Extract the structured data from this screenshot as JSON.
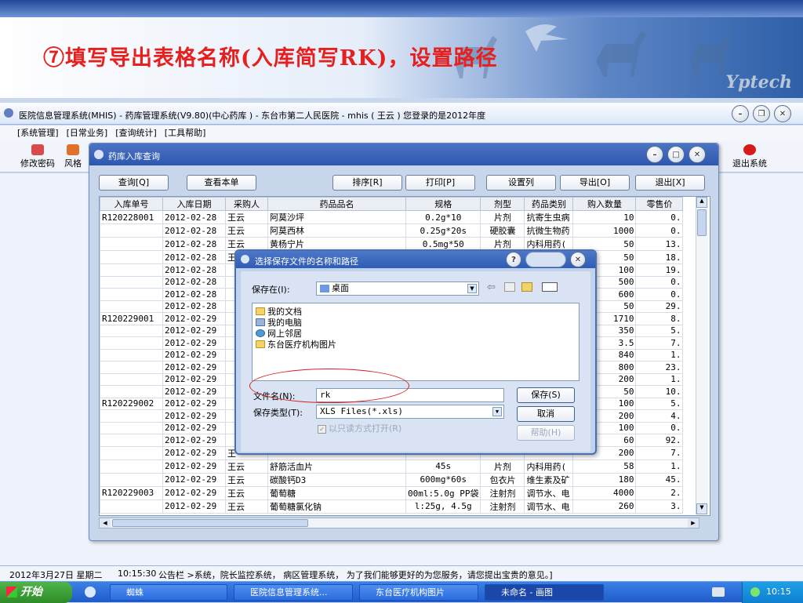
{
  "banner": {
    "title": "⑦填写导出表格名称(入库简写RK)，设置路径",
    "brand": "Yptech"
  },
  "main_window": {
    "title": "医院信息管理系统(MHIS) - 药库管理系统(V9.80)(中心药库 ) - 东台市第二人民医院 - mhis ( 王云 ) 您登录的是2012年度"
  },
  "menu": [
    "[系统管理]",
    "[日常业务]",
    "[查询统计]",
    "[工具帮助]"
  ],
  "toolbar": {
    "change_password": "修改密码",
    "style": "风格",
    "exit": "退出系统"
  },
  "child": {
    "title": "药库入库查询",
    "buttons": {
      "query": "查询[Q]",
      "view_detail": "查看本单",
      "sort": "排序[R]",
      "print": "打印[P]",
      "set_columns": "设置列",
      "export": "导出[O]",
      "exit": "退出[X]"
    }
  },
  "table": {
    "headers": [
      "入库单号",
      "入库日期",
      "采购人",
      "药品品名",
      "规格",
      "剂型",
      "药品类别",
      "购入数量",
      "零售价"
    ],
    "rows": [
      [
        "R120228001",
        "2012-02-28",
        "王云",
        "阿莫沙坪",
        "0.2g*10",
        "片剂",
        "抗寄生虫病",
        "10",
        "0."
      ],
      [
        "",
        "2012-02-28",
        "王云",
        "阿莫西林",
        "0.25g*20s",
        "硬胶囊",
        "抗微生物药",
        "1000",
        "0."
      ],
      [
        "",
        "2012-02-28",
        "王云",
        "黄杨宁片",
        "0.5mg*50",
        "片剂",
        "内科用药(",
        "50",
        "13."
      ],
      [
        "",
        "2012-02-28",
        "王云",
        "健胃消炎颗粒",
        "5g*6",
        "颗粒剂",
        "",
        "50",
        "18."
      ],
      [
        "",
        "2012-02-28",
        "",
        "",
        "",
        "",
        "",
        "100",
        "19."
      ],
      [
        "",
        "2012-02-28",
        "",
        "",
        "",
        "",
        "",
        "500",
        "0."
      ],
      [
        "",
        "2012-02-28",
        "",
        "",
        "",
        "",
        "",
        "600",
        "0."
      ],
      [
        "",
        "2012-02-28",
        "",
        "",
        "",
        "",
        "",
        "50",
        "29."
      ],
      [
        "R120229001",
        "2012-02-29",
        "",
        "",
        "",
        "",
        "",
        "1710",
        "8."
      ],
      [
        "",
        "2012-02-29",
        "",
        "",
        "",
        "",
        "",
        "350",
        "5."
      ],
      [
        "",
        "2012-02-29",
        "",
        "",
        "",
        "",
        "",
        "3.5",
        "7."
      ],
      [
        "",
        "2012-02-29",
        "",
        "",
        "",
        "",
        "",
        "840",
        "1."
      ],
      [
        "",
        "2012-02-29",
        "",
        "",
        "",
        "",
        "",
        "800",
        "23."
      ],
      [
        "",
        "2012-02-29",
        "",
        "",
        "",
        "",
        "",
        "200",
        "1."
      ],
      [
        "",
        "2012-02-29",
        "",
        "",
        "",
        "",
        "",
        "50",
        "10."
      ],
      [
        "R120229002",
        "2012-02-29",
        "",
        "",
        "",
        "",
        "",
        "100",
        "5."
      ],
      [
        "",
        "2012-02-29",
        "",
        "",
        "",
        "",
        "",
        "200",
        "4."
      ],
      [
        "",
        "2012-02-29",
        "",
        "",
        "",
        "",
        "",
        "100",
        "0."
      ],
      [
        "",
        "2012-02-29",
        "",
        "",
        "",
        "",
        "",
        "60",
        "92."
      ],
      [
        "",
        "2012-02-29",
        "王",
        "",
        "",
        "",
        "",
        "200",
        "7."
      ],
      [
        "",
        "2012-02-29",
        "王云",
        "舒筋活血片",
        "45s",
        "片剂",
        "内科用药(",
        "58",
        "1."
      ],
      [
        "",
        "2012-02-29",
        "王云",
        "碳酸钙D3",
        "600mg*60s",
        "包衣片",
        "维生素及矿",
        "180",
        "45."
      ],
      [
        "R120229003",
        "2012-02-29",
        "王云",
        "葡萄糖",
        "00ml:5.0g PP袋",
        "注射剂",
        "调节水、电",
        "4000",
        "2."
      ],
      [
        "",
        "2012-02-29",
        "王云",
        "葡萄糖氯化钠",
        "l:25g, 4.5g",
        "注射剂",
        "调节水、电",
        "260",
        "3."
      ]
    ]
  },
  "dialog": {
    "title": "选择保存文件的名称和路径",
    "save_in_label": "保存在(I):",
    "save_in_value": "桌面",
    "files": [
      "我的文档",
      "我的电脑",
      "网上邻居",
      "东台医疗机构图片"
    ],
    "filename_label": "文件名(N):",
    "filename_value": "rk",
    "filetype_label": "保存类型(T):",
    "filetype_value": "XLS Files(*.xls)",
    "readonly_label": "以只读方式打开(R)",
    "save": "保存(S)",
    "cancel": "取消",
    "help": "帮助(H)"
  },
  "status": {
    "date": "2012年3月27日  星期二",
    "time": "10:15:30",
    "notice": "公告栏  >系统，院长监控系统， 病区管理系统， 为了我们能够更好的为您服务，请您提出宝贵的意见。]"
  },
  "taskbar": {
    "start": "开始",
    "tasks": [
      "蜘蛛",
      "医院信息管理系统...",
      "东台医疗机构图片",
      "未命名 - 画图"
    ],
    "clock": "10:15"
  }
}
